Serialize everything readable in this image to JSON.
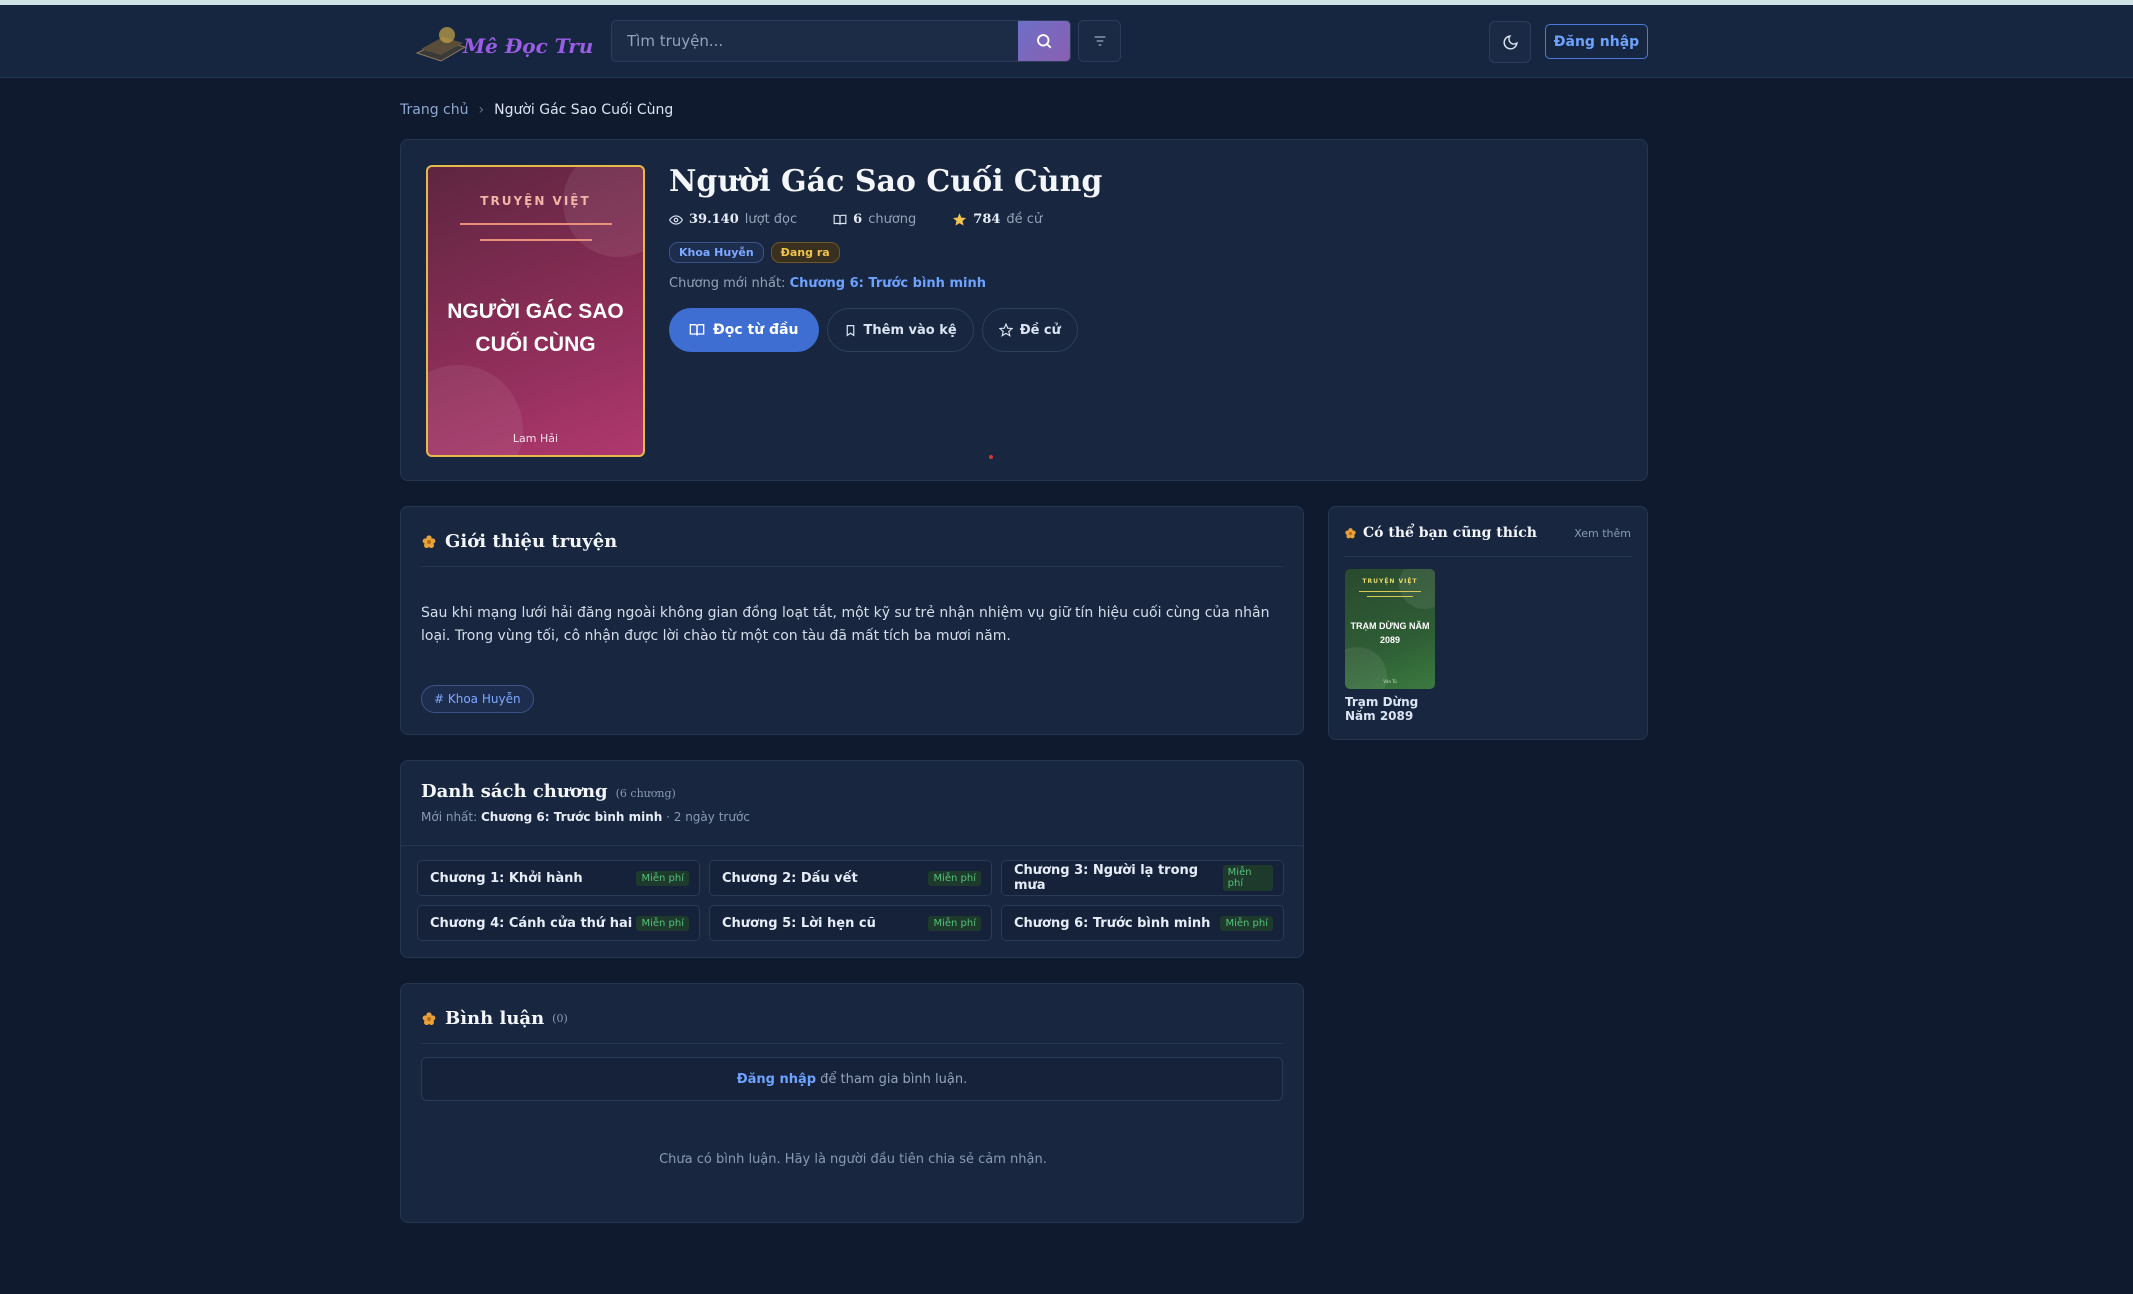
{
  "header": {
    "logo_text": "Mê Đọc Truyện",
    "search_placeholder": "Tìm truyện...",
    "login_label": "Đăng nhập"
  },
  "breadcrumb": {
    "home": "Trang chủ",
    "separator": "›",
    "current": "Người Gác Sao Cuối Cùng"
  },
  "story": {
    "title": "Người Gác Sao Cuối Cùng",
    "cover": {
      "tag": "TRUYỆN VIỆT",
      "title": "NGƯỜI GÁC SAO CUỐI CÙNG",
      "author": "Lam Hải"
    },
    "stats": {
      "views_value": "39.140",
      "views_label": "lượt đọc",
      "chapters_value": "6",
      "chapters_label": "chương",
      "votes_value": "784",
      "votes_label": "đề cử"
    },
    "genre_badge": "Khoa Huyễn",
    "status_badge": "Đang ra",
    "latest_label": "Chương mới nhất:",
    "latest_chapter": "Chương 6: Trước bình minh",
    "actions": {
      "read": "Đọc từ đầu",
      "bookshelf": "Thêm vào kệ",
      "vote": "Đề cử"
    }
  },
  "intro": {
    "heading": "Giới thiệu truyện",
    "text": "Sau khi mạng lưới hải đăng ngoài không gian đồng loạt tắt, một kỹ sư trẻ nhận nhiệm vụ giữ tín hiệu cuối cùng của nhân loại. Trong vùng tối, cô nhận được lời chào từ một con tàu đã mất tích ba mươi năm.",
    "tag": "# Khoa Huyễn"
  },
  "sidebar": {
    "heading": "Có thể bạn cũng thích",
    "more": "Xem thêm",
    "items": [
      {
        "cover_tag": "TRUYỆN VIỆT",
        "cover_title": "TRẠM DỪNG NĂM 2089",
        "cover_author": "Văn Tú",
        "title": "Trạm Dừng Năm 2089"
      }
    ]
  },
  "chapters": {
    "heading": "Danh sách chương",
    "count": "(6 chương)",
    "latest_label": "Mới nhất:",
    "latest_name": "Chương 6: Trước bình minh",
    "latest_time": "· 2 ngày trước",
    "items": [
      {
        "name": "Chương 1: Khởi hành",
        "price": "Miễn phí"
      },
      {
        "name": "Chương 2: Dấu vết",
        "price": "Miễn phí"
      },
      {
        "name": "Chương 3: Người lạ trong mưa",
        "price": "Miễn phí"
      },
      {
        "name": "Chương 4: Cánh cửa thứ hai",
        "price": "Miễn phí"
      },
      {
        "name": "Chương 5: Lời hẹn cũ",
        "price": "Miễn phí"
      },
      {
        "name": "Chương 6: Trước bình minh",
        "price": "Miễn phí"
      }
    ]
  },
  "comments": {
    "heading": "Bình luận",
    "count": "(0)",
    "login_link": "Đăng nhập",
    "login_suffix": "để tham gia bình luận.",
    "empty": "Chưa có bình luận. Hãy là người đầu tiên chia sẻ cảm nhận."
  },
  "colors": {
    "background": "#0f1a2e",
    "card": "#18263f",
    "accent": "#3e6ed2",
    "link": "#6ea2ff",
    "status": "#f0c44e",
    "free": "#55c27a"
  }
}
